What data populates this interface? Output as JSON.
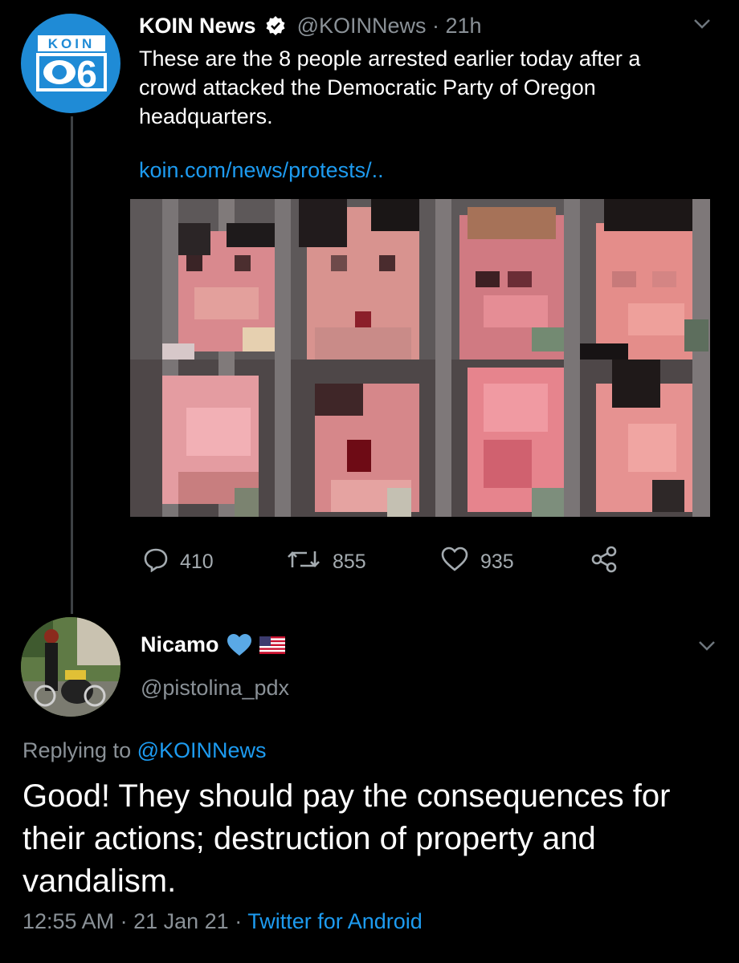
{
  "tweet": {
    "display_name": "KOIN News",
    "handle": "@KOINNews",
    "separator": " · ",
    "time_ago": "21h",
    "text": "These are the 8 people arrested earlier today after a crowd attacked the Democratic Party of Oregon headquarters.",
    "link": "koin.com/news/protests/..",
    "avatar_logo_word": "KOIN",
    "avatar_logo_number": "6",
    "verified_icon": "verified-badge-icon",
    "menu_icon": "chevron-down-icon",
    "image_desc_icon": "pixelated-mugshots-image",
    "actions": {
      "replies": "410",
      "retweets": "855",
      "likes": "935"
    }
  },
  "reply": {
    "display_name": "Nicamo",
    "handle": "@pistolina_pdx",
    "replying_prefix": "Replying to ",
    "replying_to": "@KOINNews",
    "text": "Good! They should pay the consequences for their actions; destruction of property and vandalism.",
    "time": "12:55 AM",
    "separator": " · ",
    "date": "21 Jan 21",
    "source": "Twitter for Android",
    "name_emojis": [
      "blue-heart-icon",
      "us-flag-icon"
    ],
    "menu_icon": "chevron-down-icon"
  },
  "colors": {
    "background": "#000000",
    "accent": "#1d9bf0",
    "secondary_text": "#8a9197",
    "thread_line": "#3d4144"
  }
}
